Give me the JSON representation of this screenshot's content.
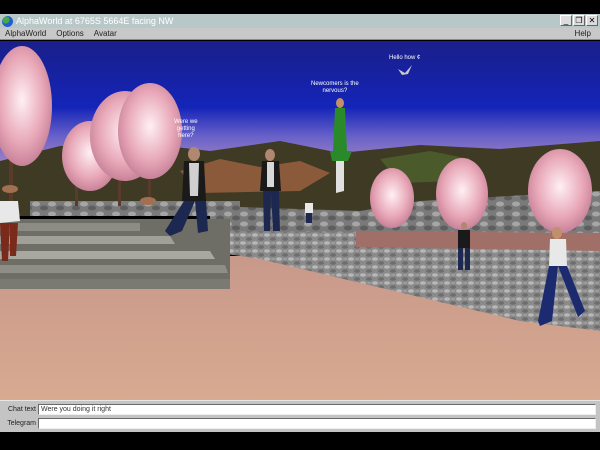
{
  "window": {
    "title": "AlphaWorld at 6765S 5664E facing NW",
    "buttons": [
      "_",
      "❐",
      "✕"
    ]
  },
  "menu": {
    "items": [
      "AlphaWorld",
      "Options",
      "Avatar"
    ],
    "help": "Help"
  },
  "scene": {
    "chat": [
      {
        "text": "Hello how ¢"
      },
      {
        "text": "Newcomers is the\nnervous?"
      },
      {
        "text": "Were we\ngetting\nhere?"
      }
    ]
  },
  "bottom": {
    "chat_label": "Chat text",
    "chat_value": "Were you doing it right",
    "telegram_label": "Telegram",
    "telegram_value": ""
  }
}
